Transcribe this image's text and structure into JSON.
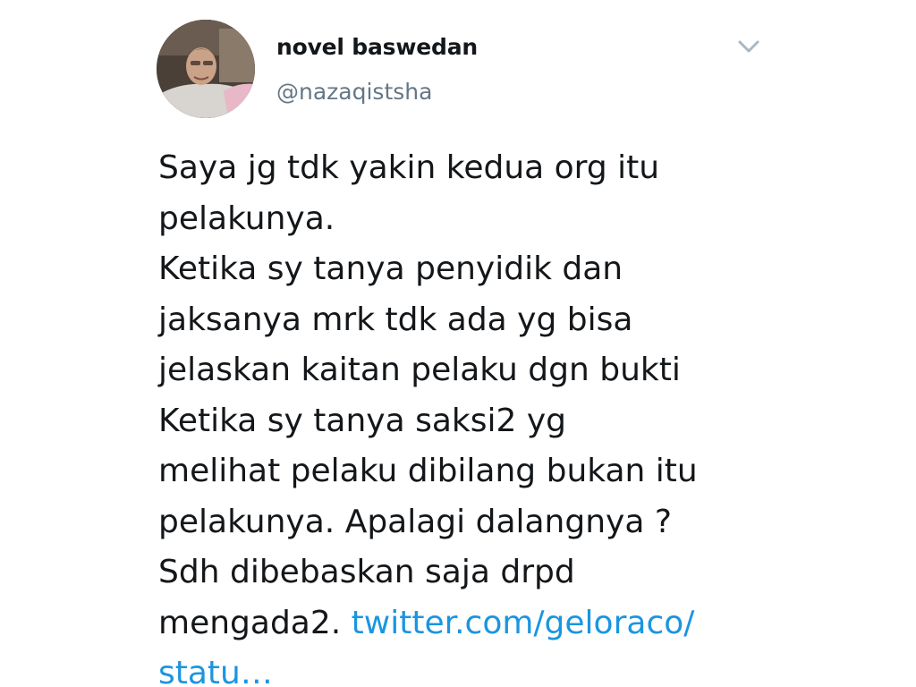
{
  "author": {
    "name": "novel baswedan",
    "handle": "@nazaqistsha"
  },
  "icons": {
    "menu": "chevron-down-icon",
    "avatar": "profile-photo"
  },
  "tweet": {
    "lines": [
      "Saya jg tdk yakin kedua org itu",
      "pelakunya.",
      "Ketika sy tanya penyidik dan",
      "jaksanya mrk tdk ada yg bisa",
      "jelaskan kaitan pelaku dgn bukti",
      "Ketika sy tanya saksi2 yg",
      "melihat pelaku dibilang bukan itu",
      "pelakunya. Apalagi dalangnya ?",
      "Sdh dibebaskan saja drpd"
    ],
    "last_line_text": "mengada2. ",
    "link_part1": "twitter.com/geloraco/",
    "link_part2": "statu…"
  },
  "colors": {
    "text": "#14171a",
    "handle": "#657786",
    "link": "#1b95e0",
    "caret": "#aab8c2"
  }
}
